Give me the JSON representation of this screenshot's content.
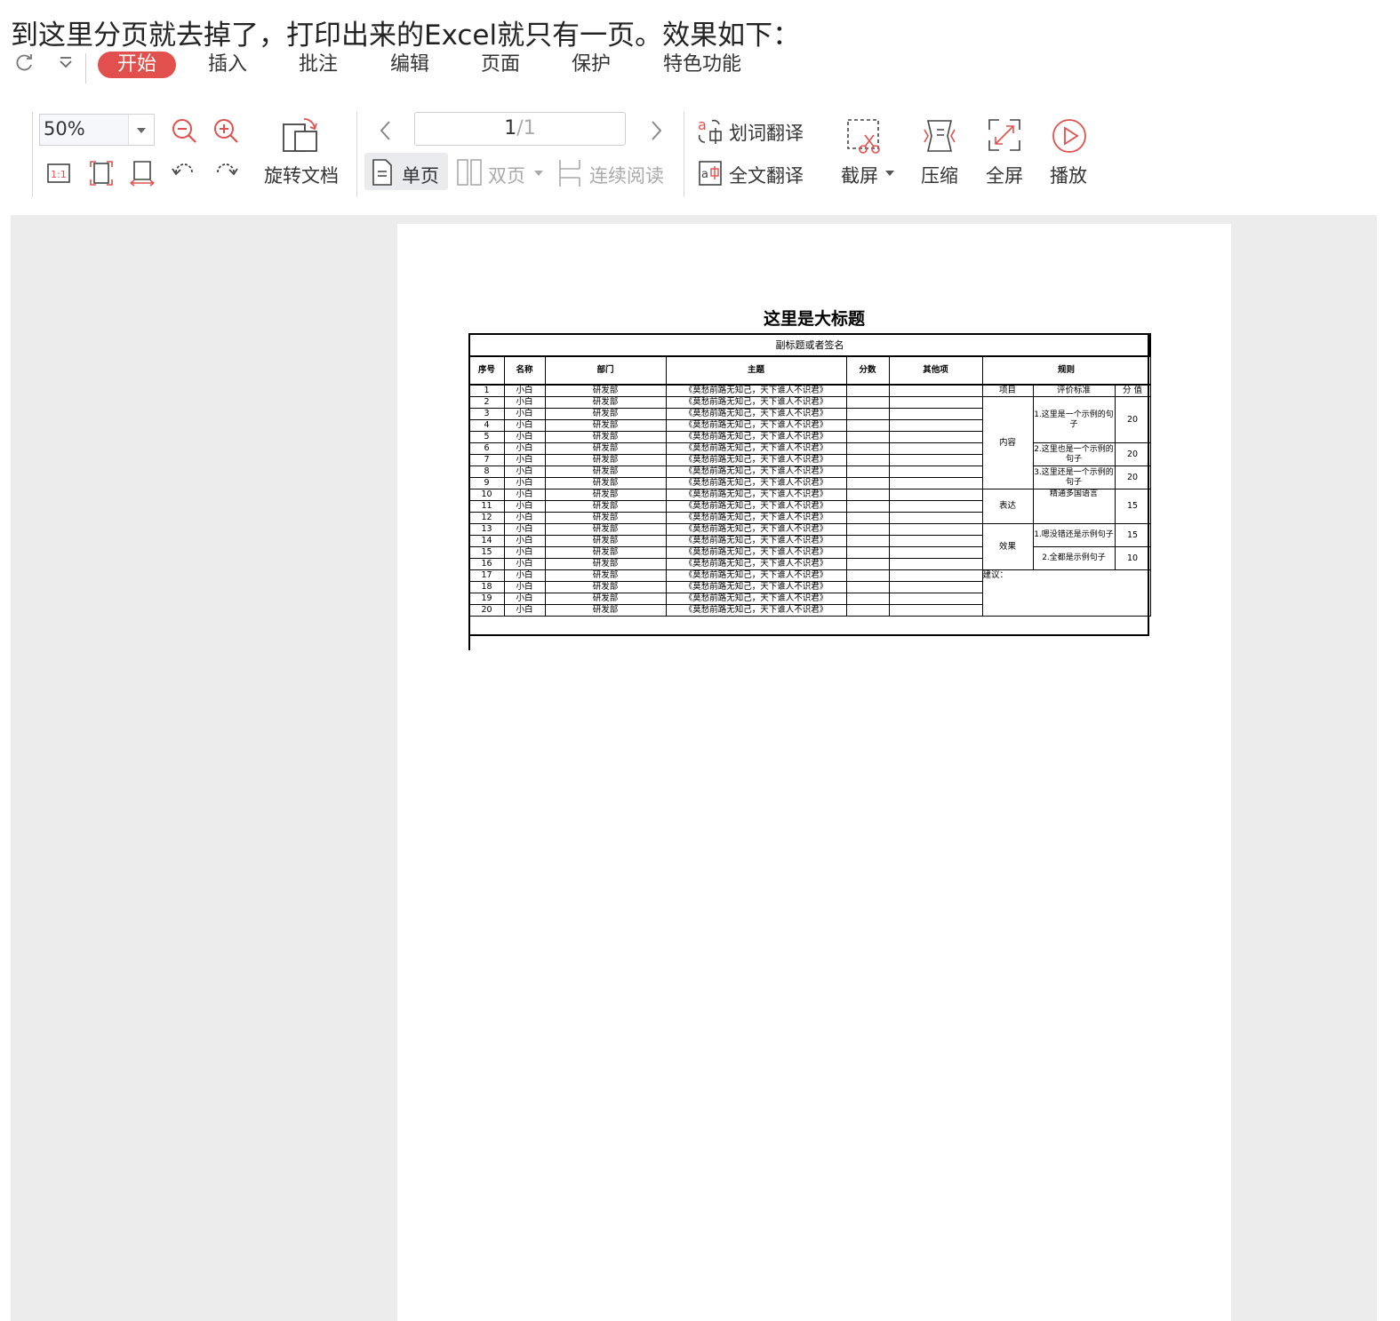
{
  "caption": "到这里分页就去掉了，打印出来的Excel就只有一页。效果如下：",
  "ribbon": {
    "tabs": [
      "开始",
      "插入",
      "批注",
      "编辑",
      "页面",
      "保护",
      "特色功能"
    ]
  },
  "toolbar": {
    "zoom": "50%",
    "rotate_label": "旋转文档",
    "page_current": "1",
    "page_total": "/1",
    "single_label": "单页",
    "double_label": "双页",
    "continuous_label": "连续阅读",
    "word_translate_label": "划词翻译",
    "full_translate_label": "全文翻译",
    "screenshot_label": "截屏",
    "compress_label": "压缩",
    "fullscreen_label": "全屏",
    "play_label": "播放"
  },
  "sheet": {
    "title": "这里是大标题",
    "subtitle": "副标题或者签名",
    "headers": [
      "序号",
      "名称",
      "部门",
      "主题",
      "分数",
      "其他项",
      "规则"
    ],
    "row_name": "小白",
    "row_dept": "研发部",
    "row_topic": "《莫愁前路无知己，天下谁人不识君》",
    "rows": [
      "1",
      "2",
      "3",
      "4",
      "5",
      "6",
      "7",
      "8",
      "9",
      "10",
      "11",
      "12",
      "13",
      "14",
      "15",
      "16",
      "17",
      "18",
      "19",
      "20"
    ],
    "rule_headers": [
      "项目",
      "评价标准",
      "分 值"
    ],
    "rules": {
      "content_label": "内容",
      "content_items": [
        {
          "text": "1.这里是一个示例的句子",
          "score": "20"
        },
        {
          "text": "2.这里也是一个示例的句子",
          "score": "20"
        },
        {
          "text": "3.这里还是一个示例的句子",
          "score": "20"
        }
      ],
      "express_label": "表达",
      "express_item": {
        "text": "精通多国语言",
        "score": "15"
      },
      "effect_label": "效果",
      "effect_items": [
        {
          "text": "1.嗯没错还是示例句子",
          "score": "15"
        },
        {
          "text": "2.全都是示例句子",
          "score": "10"
        }
      ],
      "suggest_label": "建议："
    }
  }
}
